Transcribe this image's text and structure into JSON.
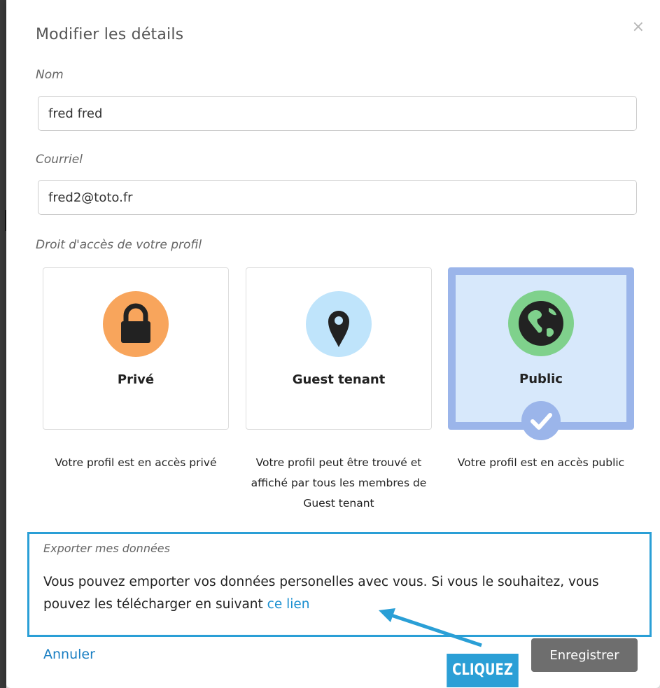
{
  "dialog": {
    "title": "Modifier les détails",
    "close_icon": "×"
  },
  "form": {
    "name": {
      "label": "Nom",
      "value": "fred fred"
    },
    "email": {
      "label": "Courriel",
      "value": "fred2@toto.fr"
    },
    "access_label": "Droit d'accès de votre profil",
    "access_options": [
      {
        "title": "Privé",
        "icon": "lock-icon",
        "color": "#f8a55c",
        "description": "Votre profil est en accès privé",
        "selected": false
      },
      {
        "title": "Guest tenant",
        "icon": "map-pin-icon",
        "color": "#bfe4fb",
        "description": "Votre profil peut être trouvé et affiché par tous les membres de Guest tenant",
        "selected": false
      },
      {
        "title": "Public",
        "icon": "globe-icon",
        "color": "#7fd18c",
        "description": "Votre profil est en accès public",
        "selected": true
      }
    ]
  },
  "export": {
    "label": "Exporter mes données",
    "text_before_link": "Vous pouvez emporter vos données personelles avec vous. Si vous le souhaitez, vous pouvez les télécharger en suivant ",
    "link_text": "ce lien"
  },
  "actions": {
    "cancel_label": "Annuler",
    "save_label": "Enregistrer"
  },
  "annotation": {
    "callout_text": "CLIQUEZ"
  },
  "colors": {
    "accent": "#2a9fd6",
    "selected_border": "#9bb5ea",
    "selected_bg": "#d7e8fb",
    "save_button": "#6e6e6e"
  }
}
